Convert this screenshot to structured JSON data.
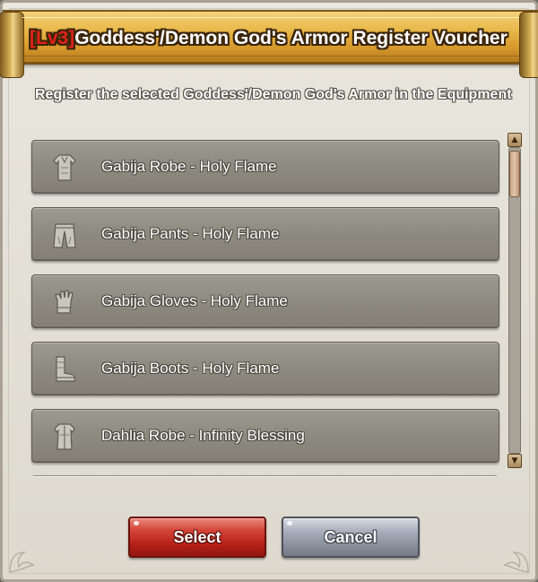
{
  "dialog": {
    "title_level": "[Lv3]",
    "title_text": "Goddess'/Demon God's Armor Register Voucher",
    "description": "Register the selected Goddess'/Demon God's Armor in the Equipment"
  },
  "items": [
    {
      "label": "Gabija Robe - Holy Flame",
      "icon": "robe-icon"
    },
    {
      "label": "Gabija Pants - Holy Flame",
      "icon": "pants-icon"
    },
    {
      "label": "Gabija Gloves - Holy Flame",
      "icon": "gloves-icon"
    },
    {
      "label": "Gabija Boots - Holy Flame",
      "icon": "boots-icon"
    },
    {
      "label": "Dahlia Robe - Infinity Blessing",
      "icon": "robe-icon"
    }
  ],
  "buttons": {
    "select_label": "Select",
    "cancel_label": "Cancel"
  },
  "scrollbar": {
    "position": 0.0
  },
  "colors": {
    "title_gold": "#e9b94c",
    "level_red": "#e0221b",
    "select_red": "#b51f18",
    "cancel_gray": "#8b909d",
    "item_gray": "#8d8a80"
  }
}
